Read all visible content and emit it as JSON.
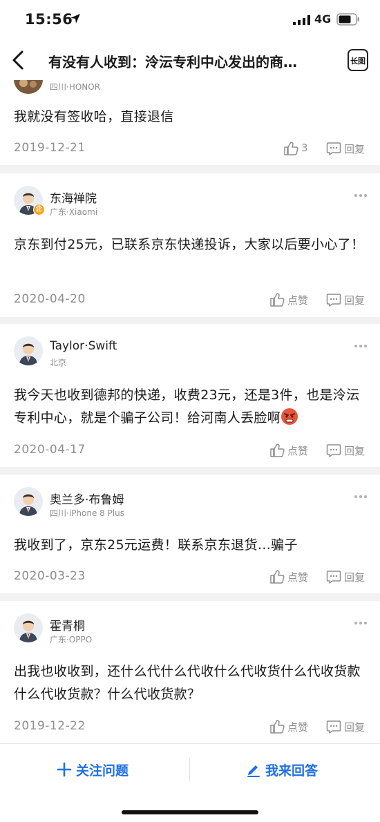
{
  "status_bar": {
    "time": "15:56",
    "network": "4G"
  },
  "nav": {
    "title": "有没有人收到：泠沄专利中心发出的商…",
    "long_image_label": "长图"
  },
  "answers": [
    {
      "meta": "四川·HONOR",
      "content": "我就没有签收哈，直接退信",
      "date": "2019-12-21",
      "like_text": "3",
      "reply_text": "回复"
    },
    {
      "username": "东海禅院",
      "badge": "企",
      "meta": "广东·Xiaomi",
      "content": "京东到付25元，已联系京东快递投诉，大家以后要小心了！",
      "date": "2020-04-20",
      "like_text": "点赞",
      "reply_text": "回复"
    },
    {
      "username": "Taylor·Swift",
      "meta": "北京",
      "content": "我今天也收到德邦的快递，收费23元，还是3件，也是泠沄专利中心，就是个骗子公司！给河南人丢脸啊",
      "emoji": "angry-face-icon",
      "date": "2020-04-17",
      "like_text": "点赞",
      "reply_text": "回复"
    },
    {
      "username": "奥兰多·布鲁姆",
      "meta": "四川·iPhone 8 Plus",
      "content": "我收到了，京东25元运费！联系京东退货…骗子",
      "date": "2020-03-23",
      "like_text": "点赞",
      "reply_text": "回复"
    },
    {
      "username": "霍青桐",
      "meta": "广东·OPPO",
      "content": "出我也收收到，还什么代什么代收什么代收货什么代收货款什么代收货款？什么代收货款？",
      "date": "2019-12-22",
      "like_text": "点赞",
      "reply_text": "回复"
    }
  ],
  "bottom_bar": {
    "follow_label": "关注问题",
    "answer_label": "我来回答"
  },
  "colors": {
    "accent": "#1f6fe5",
    "meta_gray": "#8e8e8e",
    "separator": "#f2f2f2"
  }
}
